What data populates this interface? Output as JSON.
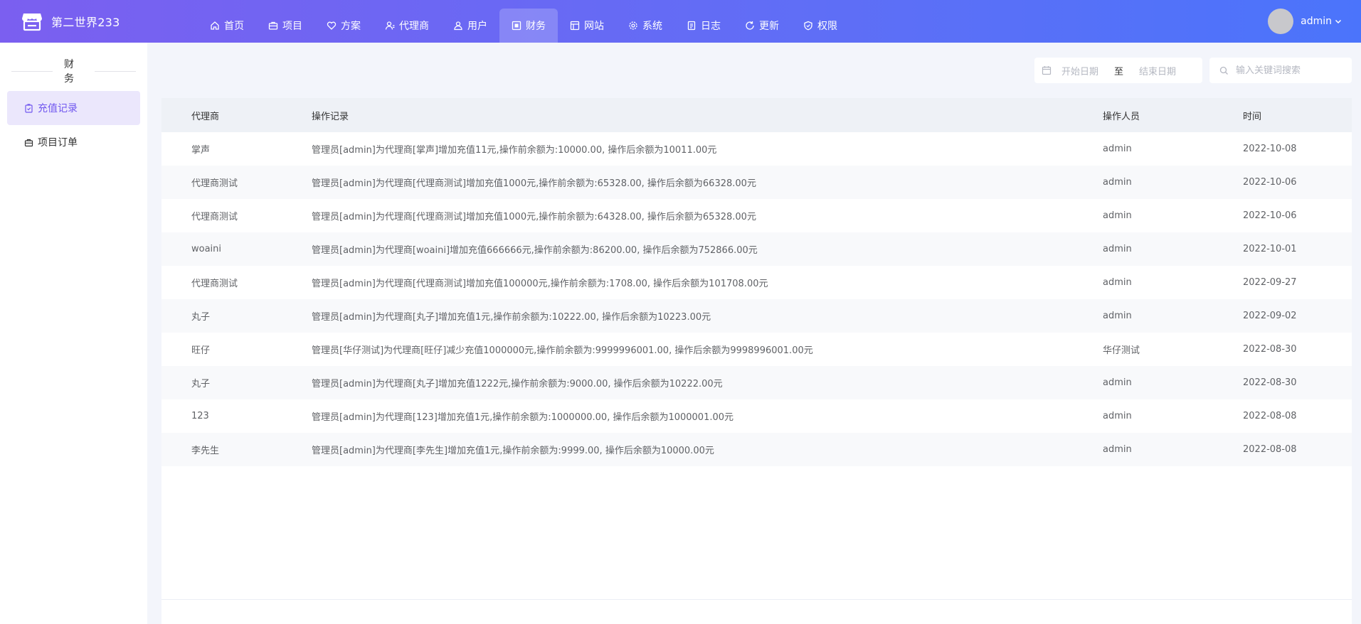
{
  "brand": {
    "name": "第二世界233"
  },
  "nav": [
    {
      "label": "首页",
      "icon": "home-icon"
    },
    {
      "label": "项目",
      "icon": "briefcase-icon"
    },
    {
      "label": "方案",
      "icon": "heart-icon"
    },
    {
      "label": "代理商",
      "icon": "user-icon"
    },
    {
      "label": "用户",
      "icon": "users-icon"
    },
    {
      "label": "财务",
      "icon": "finance-icon",
      "active": true
    },
    {
      "label": "网站",
      "icon": "window-icon"
    },
    {
      "label": "系统",
      "icon": "gear-icon"
    },
    {
      "label": "日志",
      "icon": "log-icon"
    },
    {
      "label": "更新",
      "icon": "refresh-icon"
    },
    {
      "label": "权限",
      "icon": "shield-icon"
    }
  ],
  "user": {
    "name": "admin"
  },
  "sidebar": {
    "title": "财务",
    "items": [
      {
        "label": "充值记录",
        "active": true
      },
      {
        "label": "项目订单"
      }
    ]
  },
  "filters": {
    "start_placeholder": "开始日期",
    "separator": "至",
    "end_placeholder": "结束日期",
    "search_placeholder": "输入关键词搜索"
  },
  "table": {
    "headers": {
      "agent": "代理商",
      "record": "操作记录",
      "operator": "操作人员",
      "time": "时间"
    },
    "rows": [
      {
        "agent": "掌声",
        "record": "管理员[admin]为代理商[掌声]增加充值11元,操作前余额为:10000.00, 操作后余额为10011.00元",
        "operator": "admin",
        "time": "2022-10-08"
      },
      {
        "agent": "代理商测试",
        "record": "管理员[admin]为代理商[代理商测试]增加充值1000元,操作前余额为:65328.00, 操作后余额为66328.00元",
        "operator": "admin",
        "time": "2022-10-06"
      },
      {
        "agent": "代理商测试",
        "record": "管理员[admin]为代理商[代理商测试]增加充值1000元,操作前余额为:64328.00, 操作后余额为65328.00元",
        "operator": "admin",
        "time": "2022-10-06"
      },
      {
        "agent": "woaini",
        "record": "管理员[admin]为代理商[woaini]增加充值666666元,操作前余额为:86200.00, 操作后余额为752866.00元",
        "operator": "admin",
        "time": "2022-10-01"
      },
      {
        "agent": "代理商测试",
        "record": "管理员[admin]为代理商[代理商测试]增加充值100000元,操作前余额为:1708.00, 操作后余额为101708.00元",
        "operator": "admin",
        "time": "2022-09-27"
      },
      {
        "agent": "丸子",
        "record": "管理员[admin]为代理商[丸子]增加充值1元,操作前余额为:10222.00, 操作后余额为10223.00元",
        "operator": "admin",
        "time": "2022-09-02"
      },
      {
        "agent": "旺仔",
        "record": "管理员[华仔测试]为代理商[旺仔]减少充值1000000元,操作前余额为:9999996001.00, 操作后余额为9998996001.00元",
        "operator": "华仔测试",
        "time": "2022-08-30"
      },
      {
        "agent": "丸子",
        "record": "管理员[admin]为代理商[丸子]增加充值1222元,操作前余额为:9000.00, 操作后余额为10222.00元",
        "operator": "admin",
        "time": "2022-08-30"
      },
      {
        "agent": "123",
        "record": "管理员[admin]为代理商[123]增加充值1元,操作前余额为:1000000.00, 操作后余额为1000001.00元",
        "operator": "admin",
        "time": "2022-08-08"
      },
      {
        "agent": "李先生",
        "record": "管理员[admin]为代理商[李先生]增加充值1元,操作前余额为:9999.00, 操作后余额为10000.00元",
        "operator": "admin",
        "time": "2022-08-08"
      }
    ]
  },
  "colors": {
    "accent": "#7158ef",
    "header_start": "#7b5ff0",
    "header_end": "#4b74fb"
  }
}
